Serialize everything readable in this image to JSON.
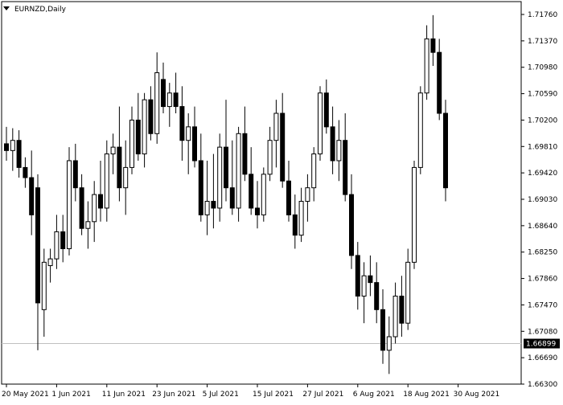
{
  "chart_data": {
    "type": "candlestick",
    "title": "EURNZD,Daily",
    "symbol": "EURNZD",
    "timeframe": "Daily",
    "current_price": "1.66899",
    "ylim": [
      1.663,
      1.7195
    ],
    "y_ticks": [
      "1.71760",
      "1.71370",
      "1.70980",
      "1.70590",
      "1.70200",
      "1.69810",
      "1.69420",
      "1.69030",
      "1.68640",
      "1.68250",
      "1.67860",
      "1.67470",
      "1.67080",
      "1.66690",
      "1.66300"
    ],
    "x_tick_labels": [
      {
        "index": 0,
        "label": "20 May 2021"
      },
      {
        "index": 8,
        "label": "1 Jun 2021"
      },
      {
        "index": 16,
        "label": "11 Jun 2021"
      },
      {
        "index": 24,
        "label": "23 Jun 2021"
      },
      {
        "index": 32,
        "label": "5 Jul 2021"
      },
      {
        "index": 40,
        "label": "15 Jul 2021"
      },
      {
        "index": 48,
        "label": "27 Jul 2021"
      },
      {
        "index": 56,
        "label": "6 Aug 2021"
      },
      {
        "index": 64,
        "label": "18 Aug 2021"
      },
      {
        "index": 72,
        "label": "30 Aug 2021"
      }
    ],
    "candles": [
      [
        1.6985,
        1.701,
        1.696,
        1.6975
      ],
      [
        1.6975,
        1.7008,
        1.6945,
        1.699
      ],
      [
        1.699,
        1.7005,
        1.6935,
        1.695
      ],
      [
        1.695,
        1.6965,
        1.692,
        1.6935
      ],
      [
        1.6935,
        1.6975,
        1.685,
        1.688
      ],
      [
        1.692,
        1.694,
        1.668,
        1.675
      ],
      [
        1.674,
        1.683,
        1.67,
        1.681
      ],
      [
        1.6805,
        1.683,
        1.678,
        1.6815
      ],
      [
        1.6815,
        1.688,
        1.68,
        1.6855
      ],
      [
        1.6855,
        1.688,
        1.681,
        1.683
      ],
      [
        1.683,
        1.698,
        1.682,
        1.696
      ],
      [
        1.696,
        1.6985,
        1.69,
        1.692
      ],
      [
        1.692,
        1.694,
        1.685,
        1.686
      ],
      [
        1.686,
        1.69,
        1.683,
        1.687
      ],
      [
        1.687,
        1.693,
        1.684,
        1.691
      ],
      [
        1.691,
        1.696,
        1.687,
        1.689
      ],
      [
        1.689,
        1.699,
        1.687,
        1.697
      ],
      [
        1.697,
        1.7,
        1.694,
        1.698
      ],
      [
        1.698,
        1.704,
        1.69,
        1.692
      ],
      [
        1.692,
        1.699,
        1.688,
        1.695
      ],
      [
        1.695,
        1.704,
        1.694,
        1.702
      ],
      [
        1.702,
        1.706,
        1.696,
        1.697
      ],
      [
        1.697,
        1.706,
        1.695,
        1.705
      ],
      [
        1.705,
        1.707,
        1.699,
        1.7
      ],
      [
        1.7,
        1.712,
        1.6985,
        1.709
      ],
      [
        1.708,
        1.7105,
        1.703,
        1.704
      ],
      [
        1.704,
        1.7075,
        1.701,
        1.706
      ],
      [
        1.706,
        1.709,
        1.703,
        1.704
      ],
      [
        1.704,
        1.707,
        1.696,
        1.699
      ],
      [
        1.699,
        1.703,
        1.694,
        1.701
      ],
      [
        1.701,
        1.704,
        1.695,
        1.696
      ],
      [
        1.696,
        1.7,
        1.687,
        1.688
      ],
      [
        1.688,
        1.696,
        1.685,
        1.69
      ],
      [
        1.69,
        1.697,
        1.686,
        1.689
      ],
      [
        1.689,
        1.7,
        1.687,
        1.698
      ],
      [
        1.698,
        1.705,
        1.69,
        1.692
      ],
      [
        1.692,
        1.699,
        1.688,
        1.689
      ],
      [
        1.689,
        1.701,
        1.687,
        1.7
      ],
      [
        1.7,
        1.704,
        1.693,
        1.694
      ],
      [
        1.694,
        1.698,
        1.688,
        1.689
      ],
      [
        1.689,
        1.693,
        1.686,
        1.688
      ],
      [
        1.688,
        1.695,
        1.687,
        1.694
      ],
      [
        1.694,
        1.701,
        1.693,
        1.699
      ],
      [
        1.699,
        1.705,
        1.695,
        1.703
      ],
      [
        1.703,
        1.706,
        1.692,
        1.693
      ],
      [
        1.693,
        1.696,
        1.687,
        1.688
      ],
      [
        1.688,
        1.691,
        1.683,
        1.685
      ],
      [
        1.685,
        1.692,
        1.684,
        1.69
      ],
      [
        1.69,
        1.694,
        1.687,
        1.692
      ],
      [
        1.692,
        1.698,
        1.69,
        1.697
      ],
      [
        1.697,
        1.707,
        1.696,
        1.706
      ],
      [
        1.706,
        1.708,
        1.7,
        1.701
      ],
      [
        1.701,
        1.704,
        1.694,
        1.696
      ],
      [
        1.696,
        1.702,
        1.693,
        1.699
      ],
      [
        1.699,
        1.703,
        1.69,
        1.691
      ],
      [
        1.691,
        1.694,
        1.68,
        1.682
      ],
      [
        1.682,
        1.684,
        1.674,
        1.676
      ],
      [
        1.676,
        1.681,
        1.672,
        1.679
      ],
      [
        1.679,
        1.682,
        1.676,
        1.678
      ],
      [
        1.678,
        1.681,
        1.672,
        1.674
      ],
      [
        1.674,
        1.677,
        1.666,
        1.668
      ],
      [
        1.668,
        1.673,
        1.6645,
        1.67
      ],
      [
        1.67,
        1.678,
        1.669,
        1.676
      ],
      [
        1.676,
        1.679,
        1.67,
        1.672
      ],
      [
        1.672,
        1.683,
        1.671,
        1.681
      ],
      [
        1.681,
        1.696,
        1.68,
        1.695
      ],
      [
        1.695,
        1.707,
        1.694,
        1.706
      ],
      [
        1.706,
        1.716,
        1.705,
        1.714
      ],
      [
        1.714,
        1.7175,
        1.71,
        1.712
      ],
      [
        1.712,
        1.714,
        1.702,
        1.703
      ],
      [
        1.703,
        1.705,
        1.69,
        1.692
      ]
    ]
  }
}
